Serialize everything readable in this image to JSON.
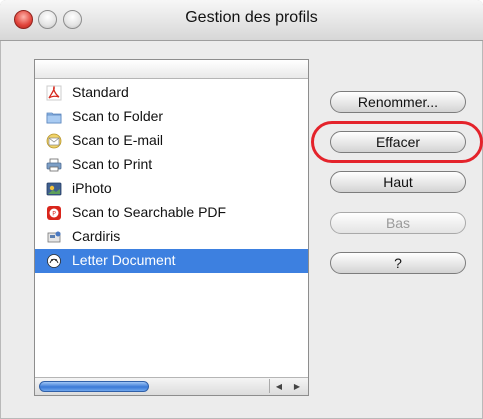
{
  "window": {
    "title": "Gestion des profils"
  },
  "list": {
    "items": [
      {
        "label": "Standard",
        "icon": "pdf-acrobat-icon",
        "selected": false
      },
      {
        "label": "Scan to Folder",
        "icon": "folder-icon",
        "selected": false
      },
      {
        "label": "Scan to E-mail",
        "icon": "envelope-icon",
        "selected": false
      },
      {
        "label": "Scan to Print",
        "icon": "printer-icon",
        "selected": false
      },
      {
        "label": "iPhoto",
        "icon": "iphoto-icon",
        "selected": false
      },
      {
        "label": "Scan to Searchable PDF",
        "icon": "searchable-pdf-icon",
        "selected": false
      },
      {
        "label": "Cardiris",
        "icon": "cardiris-icon",
        "selected": false
      },
      {
        "label": "Letter Document",
        "icon": "letter-document-icon",
        "selected": true
      }
    ]
  },
  "buttons": {
    "rename": "Renommer...",
    "delete": "Effacer",
    "up": "Haut",
    "down": "Bas",
    "help": "?"
  },
  "colors": {
    "selection": "#3d80e0",
    "highlight_ring": "#e4232b"
  }
}
